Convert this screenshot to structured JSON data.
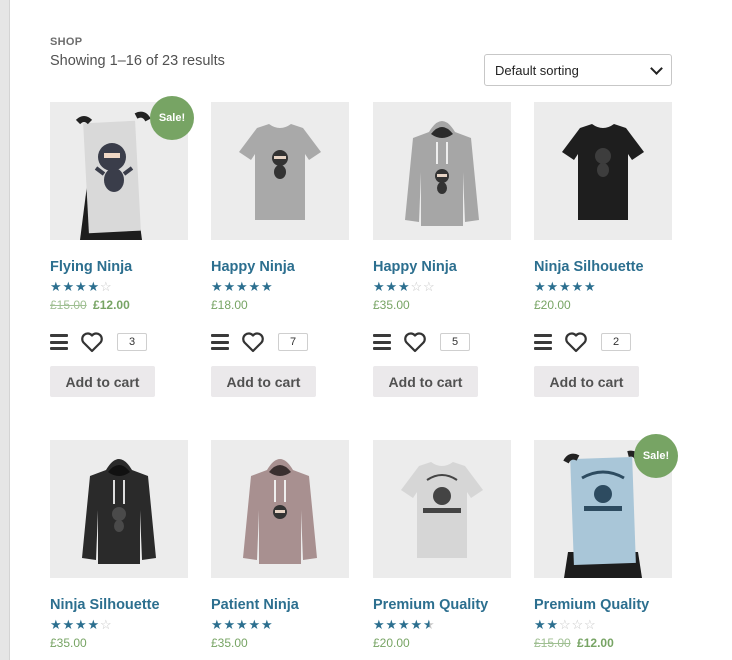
{
  "page": {
    "breadcrumb": "SHOP",
    "result_count": "Showing 1–16 of 23 results",
    "sort": {
      "selected": "Default sorting"
    }
  },
  "colors": {
    "accent_link": "#2c6f8f",
    "sale_badge": "#77a464",
    "button_bg": "#ebe9eb"
  },
  "products": [
    {
      "title": "Flying Ninja",
      "rating": 4,
      "old_price": "£15.00",
      "price": "£12.00",
      "sale_badge": "Sale!",
      "wishlist_count": "3",
      "add_to_cart": "Add to cart",
      "image": "poster-ninja"
    },
    {
      "title": "Happy Ninja",
      "rating": 5,
      "price": "£18.00",
      "wishlist_count": "7",
      "add_to_cart": "Add to cart",
      "image": "tshirt-grey-ninja"
    },
    {
      "title": "Happy Ninja",
      "rating": 3,
      "price": "£35.00",
      "wishlist_count": "5",
      "add_to_cart": "Add to cart",
      "image": "hoodie-grey-ninja"
    },
    {
      "title": "Ninja Silhouette",
      "rating": 5,
      "price": "£20.00",
      "wishlist_count": "2",
      "add_to_cart": "Add to cart",
      "image": "tshirt-black-ninja"
    },
    {
      "title": "Ninja Silhouette",
      "rating": 4,
      "price": "£35.00",
      "image": "hoodie-black-ninja"
    },
    {
      "title": "Patient Ninja",
      "rating": 5,
      "price": "£35.00",
      "image": "hoodie-mauve-ninja"
    },
    {
      "title": "Premium Quality",
      "rating": 4.5,
      "price": "£20.00",
      "image": "tshirt-white-woothemes"
    },
    {
      "title": "Premium Quality",
      "rating": 2,
      "old_price": "£15.00",
      "price": "£12.00",
      "sale_badge": "Sale!",
      "image": "poster-woothemes"
    }
  ]
}
